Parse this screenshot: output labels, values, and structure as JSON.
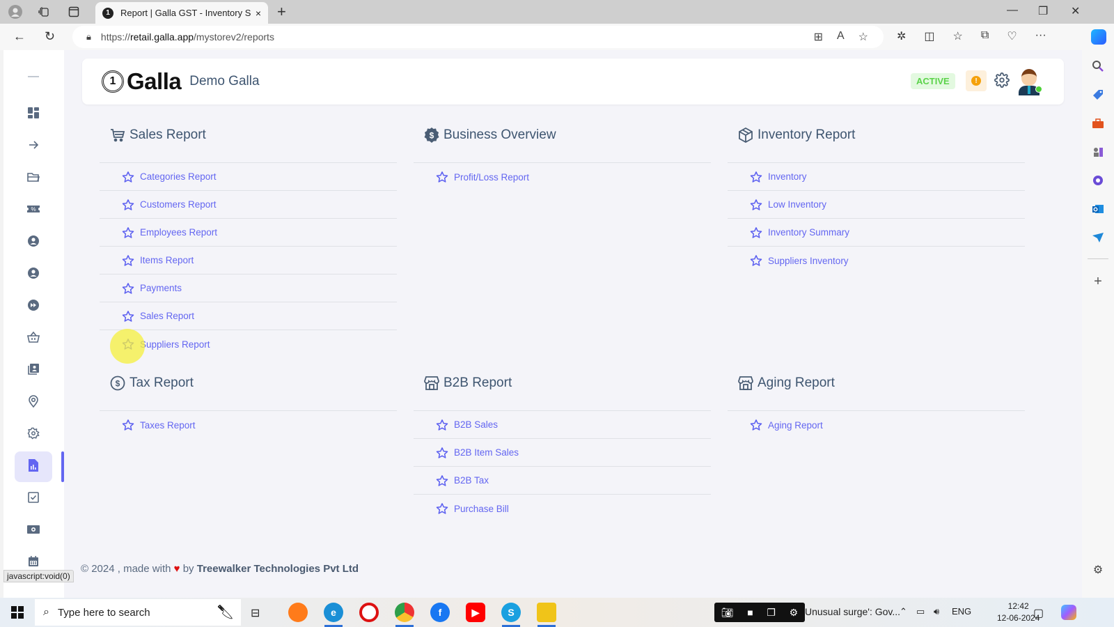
{
  "browser": {
    "tab_title": "Report | Galla GST - Inventory So",
    "tab_close": "×",
    "new_tab": "+",
    "url_scheme": "https://",
    "url_host": "retail.galla.app",
    "url_path": "/mystorev2/reports",
    "status_link": "javascript:void(0)"
  },
  "header": {
    "brand_logo_glyph": "1",
    "brand_name": "Galla",
    "store_name": "Demo Galla",
    "status_badge": "ACTIVE",
    "warning_glyph": "!"
  },
  "sections": [
    {
      "id": "sales",
      "title": "Sales Report",
      "icon": "cart-icon",
      "items": [
        "Categories Report",
        "Customers Report",
        "Employees Report",
        "Items Report",
        "Payments",
        "Sales Report",
        "Suppliers Report"
      ]
    },
    {
      "id": "business",
      "title": "Business Overview",
      "icon": "dollar-badge-icon",
      "items": [
        "Profit/Loss Report"
      ]
    },
    {
      "id": "inventory",
      "title": "Inventory Report",
      "icon": "box-icon",
      "items": [
        "Inventory",
        "Low Inventory",
        "Inventory Summary",
        "Suppliers Inventory"
      ]
    },
    {
      "id": "tax",
      "title": "Tax Report",
      "icon": "dollar-circle-icon",
      "items": [
        "Taxes Report"
      ]
    },
    {
      "id": "b2b",
      "title": "B2B Report",
      "icon": "store-icon",
      "items": [
        "B2B Sales",
        "B2B Item Sales",
        "B2B Tax",
        "Purchase Bill"
      ]
    },
    {
      "id": "aging",
      "title": "Aging Report",
      "icon": "store-icon",
      "items": [
        "Aging Report"
      ]
    }
  ],
  "sidebar": {
    "items": [
      {
        "icon": "menu-collapse-icon",
        "active": false
      },
      {
        "icon": "dashboard-icon",
        "active": false
      },
      {
        "icon": "arrow-right-icon",
        "active": false
      },
      {
        "icon": "folder-icon",
        "active": false
      },
      {
        "icon": "discount-ticket-icon",
        "active": false
      },
      {
        "icon": "user-circle-icon",
        "active": false
      },
      {
        "icon": "user-circle-icon",
        "active": false
      },
      {
        "icon": "fast-forward-icon",
        "active": false
      },
      {
        "icon": "basket-icon",
        "active": false
      },
      {
        "icon": "contacts-icon",
        "active": false
      },
      {
        "icon": "location-pin-icon",
        "active": false
      },
      {
        "icon": "settings-icon",
        "active": false
      },
      {
        "icon": "report-file-icon",
        "active": true
      },
      {
        "icon": "checkbox-icon",
        "active": false
      },
      {
        "icon": "cash-icon",
        "active": false
      },
      {
        "icon": "calendar-icon",
        "active": false
      }
    ]
  },
  "footer": {
    "prefix": "© 2024 , made with",
    "heart": "♥",
    "by": "by",
    "company": "Treewalker Technologies Pvt Ltd"
  },
  "taskbar": {
    "search_placeholder": "Type here to search",
    "news_text": "Unusual surge': Gov...",
    "language": "ENG",
    "time": "12:42",
    "date": "12-06-2024"
  },
  "colors": {
    "accent": "#6366f1",
    "active_badge_text": "#5bd34a",
    "active_badge_bg": "#e3f9e0",
    "warning": "#f5a10b",
    "heading": "#3e5570"
  }
}
